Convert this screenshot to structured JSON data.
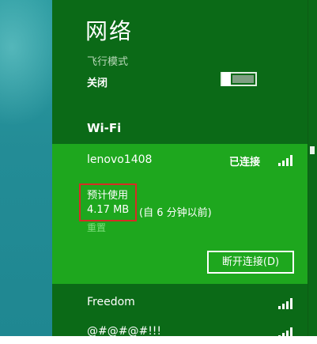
{
  "panel": {
    "title": "网络",
    "airplane_mode": {
      "label": "飞行模式",
      "state": "关闭",
      "enabled": false
    },
    "wifi_section_label": "Wi-Fi",
    "connected_network": {
      "name": "lenovo1408",
      "status": "已连接",
      "signal_bars": 4,
      "usage_label": "预计使用",
      "usage_amount": "4.17 MB",
      "usage_since": "(自 6 分钟以前)",
      "reset_label": "重置",
      "disconnect_label": "断开连接(D)"
    },
    "other_networks": [
      {
        "name": "Freedom",
        "signal_bars": 4
      },
      {
        "name": "@#@#@#!!!",
        "signal_bars": 4
      }
    ]
  },
  "colors": {
    "panel_bg": "#0b6a17",
    "selected_bg": "#1ea71e",
    "highlight_border": "#d72c25",
    "desktop": "#238c96"
  }
}
